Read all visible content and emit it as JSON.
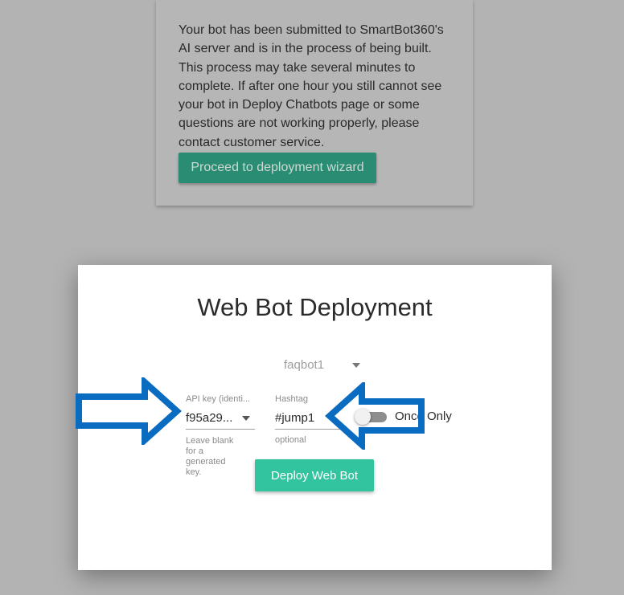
{
  "background_card": {
    "message": "Your bot has been submitted to SmartBot360's AI server and is in the process of being built. This process may take several minutes to complete. If after one hour you still cannot see your bot in Deploy Chatbots page or some questions are not working properly, please contact customer service.",
    "proceed_label": "Proceed to deployment wizard"
  },
  "modal": {
    "title": "Web Bot Deployment",
    "bot_select": {
      "value": "faqbot1"
    },
    "api_key": {
      "label": "API key (identi...",
      "value": "f95a29...",
      "help": "Leave blank for a generated key."
    },
    "hashtag": {
      "label": "Hashtag",
      "value": "#jump1",
      "help": "optional"
    },
    "once_only": {
      "label": "Once Only",
      "checked": false
    },
    "deploy_label": "Deploy Web Bot"
  },
  "colors": {
    "overlay": "#b3b3b3",
    "accent": "#31c49e",
    "annotation_arrow": "#0a6cc0"
  },
  "icons": {
    "bot_select_caret": "chevron-down-icon",
    "api_key_caret": "chevron-down-icon",
    "annotation_right": "arrow-right-icon",
    "annotation_left": "arrow-left-icon"
  }
}
